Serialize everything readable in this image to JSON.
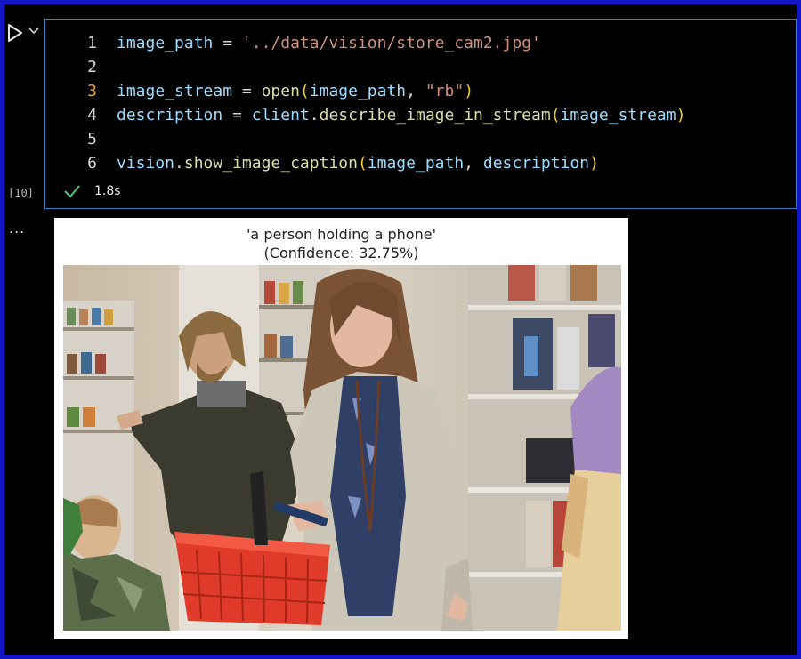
{
  "cell": {
    "execution_count": "[10]",
    "status": {
      "icon": "check-icon",
      "duration": "1.8s",
      "color": "#4ec27a"
    },
    "active_line": 3,
    "lines": [
      {
        "number": "1",
        "tokens": [
          {
            "text": "image_path",
            "kind": "var"
          },
          {
            "text": " = ",
            "kind": "op"
          },
          {
            "text": "'../data/vision/store_cam2.jpg'",
            "kind": "str"
          }
        ]
      },
      {
        "number": "2",
        "tokens": []
      },
      {
        "number": "3",
        "tokens": [
          {
            "text": "image_stream",
            "kind": "var"
          },
          {
            "text": " = ",
            "kind": "op"
          },
          {
            "text": "open",
            "kind": "fn"
          },
          {
            "text": "(",
            "kind": "par"
          },
          {
            "text": "image_path",
            "kind": "var"
          },
          {
            "text": ", ",
            "kind": "op"
          },
          {
            "text": "\"rb\"",
            "kind": "str"
          },
          {
            "text": ")",
            "kind": "par"
          }
        ]
      },
      {
        "number": "4",
        "tokens": [
          {
            "text": "description",
            "kind": "var"
          },
          {
            "text": " = ",
            "kind": "op"
          },
          {
            "text": "client",
            "kind": "var"
          },
          {
            "text": ".",
            "kind": "op"
          },
          {
            "text": "describe_image_in_stream",
            "kind": "fn"
          },
          {
            "text": "(",
            "kind": "par"
          },
          {
            "text": "image_stream",
            "kind": "var"
          },
          {
            "text": ")",
            "kind": "par"
          }
        ]
      },
      {
        "number": "5",
        "tokens": []
      },
      {
        "number": "6",
        "tokens": [
          {
            "text": "vision",
            "kind": "var"
          },
          {
            "text": ".",
            "kind": "op"
          },
          {
            "text": "show_image_caption",
            "kind": "fn"
          },
          {
            "text": "(",
            "kind": "par"
          },
          {
            "text": "image_path",
            "kind": "var"
          },
          {
            "text": ", ",
            "kind": "op"
          },
          {
            "text": "description",
            "kind": "var"
          },
          {
            "text": ")",
            "kind": "par"
          }
        ]
      }
    ]
  },
  "output": {
    "more_label": "...",
    "caption_line1": "'a person holding a phone'",
    "caption_line2": "(Confidence: 32.75%)"
  },
  "colors": {
    "frame_border": "#1515c8",
    "cell_border": "#3a7ec0",
    "basket_red": "#e03a2a"
  }
}
